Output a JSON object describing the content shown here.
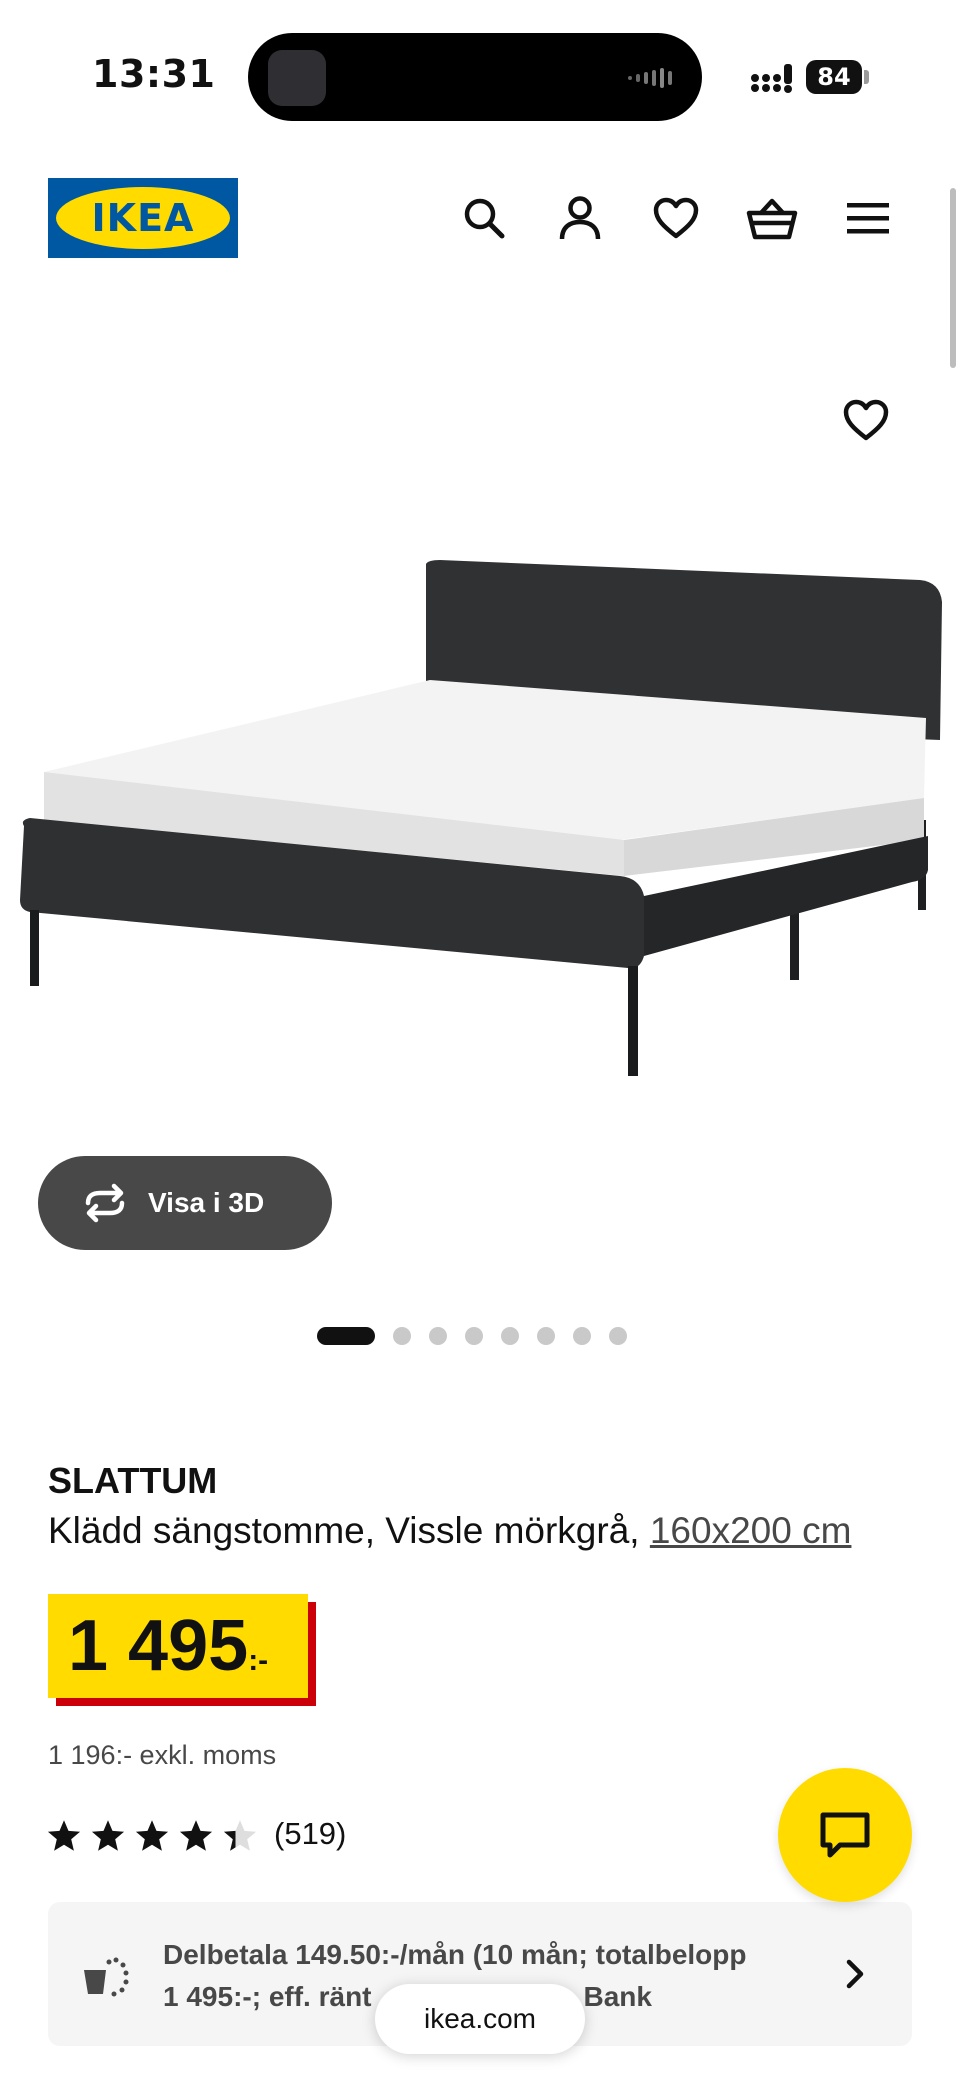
{
  "status_bar": {
    "time": "13:31",
    "battery": "84"
  },
  "header": {
    "logo_text": "IKEA",
    "icons": [
      "search-icon",
      "user-icon",
      "heart-icon",
      "basket-icon",
      "menu-icon"
    ]
  },
  "gallery": {
    "view_3d_label": "Visa i 3D",
    "dots_total": 8,
    "active_dot": 1
  },
  "product": {
    "brand": "SLATTUM",
    "description": "Klädd sängstomme, Vissle mörkgrå, ",
    "size": "160x200 cm",
    "price": "1 495",
    "price_suffix": ":-",
    "price_ex_vat": "1 196:- exkl. moms",
    "rating": 4.5,
    "review_count": "(519)"
  },
  "payment": {
    "text_line1": "Delbetala 149.50:-/mån (10 mån; totalbelopp",
    "text_line2": "1 495:-; eff. ränt",
    "text_line2_end": "no Bank"
  },
  "browser": {
    "url": "ikea.com"
  },
  "colors": {
    "ikea_blue": "#0058a3",
    "ikea_yellow": "#ffdb00",
    "price_red": "#cc0008",
    "button_dark": "#484848"
  }
}
